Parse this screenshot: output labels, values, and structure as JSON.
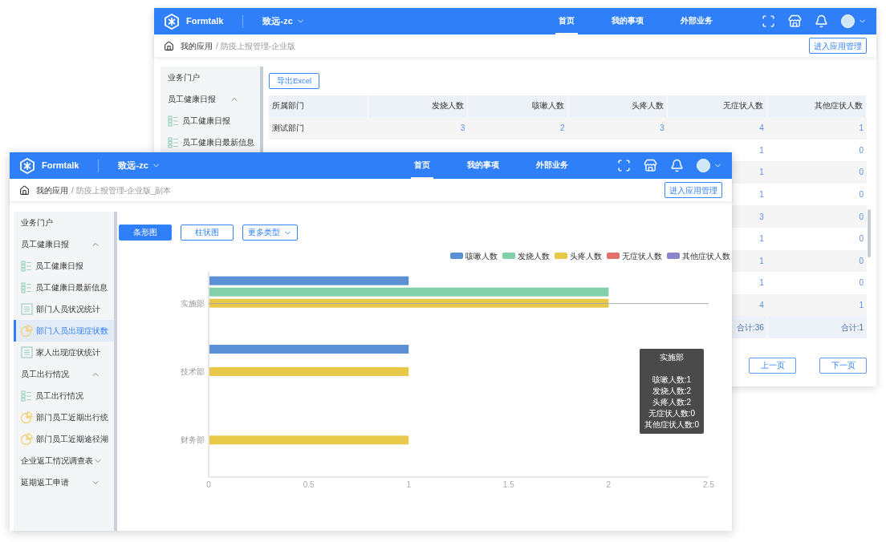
{
  "back_window": {
    "header": {
      "brand": "Formtalk",
      "workspace": "致远-zc",
      "nav": [
        {
          "label": "首页",
          "selected": true
        },
        {
          "label": "我的事项",
          "selected": false
        },
        {
          "label": "外部业务",
          "selected": false
        }
      ]
    },
    "breadcrumb": {
      "root": "我的应用",
      "path": "/ 防疫上报管理-企业版"
    },
    "manage_button": "进入应用管理",
    "sidebar": [
      {
        "label": "业务门户",
        "kind": "link"
      },
      {
        "label": "员工健康日报",
        "kind": "group",
        "expanded": true,
        "children": [
          {
            "label": "员工健康日报",
            "kind": "grid",
            "selected": false
          },
          {
            "label": "员工健康日最新信息",
            "kind": "grid",
            "selected": false
          }
        ]
      }
    ],
    "export_button": "导出Excel",
    "table": {
      "columns": [
        "所属部门",
        "发烧人数",
        "咳嗽人数",
        "头疼人数",
        "无症状人数",
        "其他症状人数"
      ],
      "rows": [
        [
          "测试部门",
          "3",
          "2",
          "3",
          "4",
          "1"
        ],
        [
          "1",
          "0"
        ],
        [
          "1",
          "0"
        ],
        [
          "1",
          "0"
        ],
        [
          "3",
          "0"
        ],
        [
          "1",
          "0"
        ],
        [
          "1",
          "0"
        ],
        [
          "1",
          "0"
        ],
        [
          "4",
          "1"
        ]
      ],
      "totals": [
        "合计:36",
        "合计:1"
      ]
    },
    "pagination": [
      "上一页",
      "下一页"
    ]
  },
  "front_window": {
    "header": {
      "brand": "Formtalk",
      "workspace": "致远-zc",
      "nav": [
        {
          "label": "首页",
          "selected": true
        },
        {
          "label": "我的事项",
          "selected": false
        },
        {
          "label": "外部业务",
          "selected": false
        }
      ]
    },
    "breadcrumb": {
      "root": "我的应用",
      "path": "/ 防疫上报管理-企业版_副本"
    },
    "manage_button": "进入应用管理",
    "sidebar": [
      {
        "label": "业务门户",
        "kind": "link"
      },
      {
        "label": "员工健康日报",
        "kind": "group",
        "expanded": true,
        "children": [
          {
            "label": "员工健康日报",
            "kind": "grid",
            "selected": false
          },
          {
            "label": "员工健康日最新信息",
            "kind": "grid",
            "selected": false
          },
          {
            "label": "部门人员状况统计",
            "kind": "doc",
            "selected": false
          },
          {
            "label": "部门人员出现症状数",
            "kind": "pie",
            "selected": true
          },
          {
            "label": "家人出现症状统计",
            "kind": "doc",
            "selected": false
          }
        ]
      },
      {
        "label": "员工出行情况",
        "kind": "group",
        "expanded": true,
        "children": [
          {
            "label": "员工出行情况",
            "kind": "grid",
            "selected": false
          },
          {
            "label": "部门员工近期出行统",
            "kind": "pie",
            "selected": false
          },
          {
            "label": "部门员工近期途径湖",
            "kind": "pie",
            "selected": false
          }
        ]
      },
      {
        "label": "企业返工情况调查表",
        "kind": "group",
        "expanded": false
      },
      {
        "label": "延期返工申请",
        "kind": "group",
        "expanded": false
      }
    ],
    "chart_types": [
      {
        "label": "条形图",
        "selected": true,
        "kind": "tab"
      },
      {
        "label": "柱状图",
        "selected": false,
        "kind": "tab"
      },
      {
        "label": "更多类型",
        "selected": false,
        "kind": "dropdown"
      }
    ],
    "chart_data": {
      "type": "bar",
      "orientation": "horizontal",
      "categories": [
        "实施部",
        "技术部",
        "财务部"
      ],
      "series": [
        {
          "name": "咳嗽人数",
          "color": "#5b8fd6",
          "values": [
            1,
            1,
            0
          ]
        },
        {
          "name": "发烧人数",
          "color": "#82cfa9",
          "values": [
            2,
            0,
            0
          ]
        },
        {
          "name": "头疼人数",
          "color": "#e8c848",
          "values": [
            2,
            1,
            1
          ]
        },
        {
          "name": "无症状人数",
          "color": "#e07068",
          "values": [
            0,
            0,
            0
          ]
        },
        {
          "name": "其他症状人数",
          "color": "#8c85cc",
          "values": [
            0,
            0,
            0
          ]
        }
      ],
      "legend": "top-right",
      "xlim": [
        0,
        2.5
      ],
      "xticks": [
        0,
        0.5,
        1,
        1.5,
        2,
        2.5
      ]
    },
    "tooltip": {
      "title": "实施部",
      "lines": [
        "咳嗽人数:1",
        "发烧人数:2",
        "头疼人数:2",
        "无症状人数:0",
        "其他症状人数:0"
      ]
    }
  }
}
